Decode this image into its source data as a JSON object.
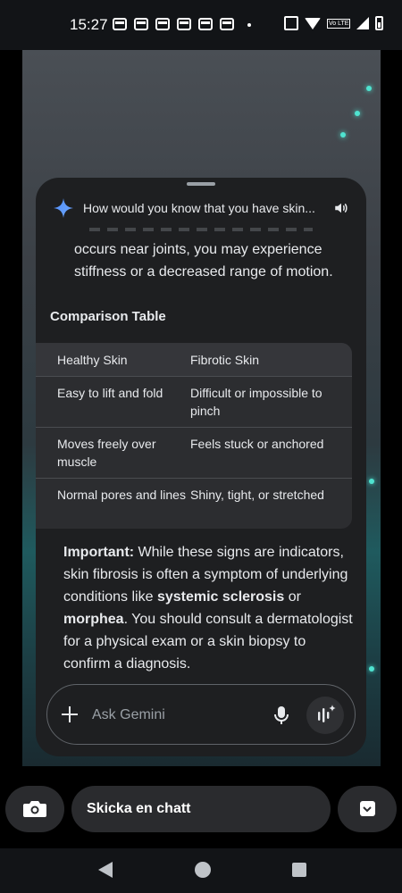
{
  "status_bar": {
    "time": "15:27",
    "notification_icons": [
      "notification-icon",
      "notification-icon",
      "notification-icon",
      "notification-icon",
      "notification-icon",
      "notification-icon"
    ],
    "volte_label": "Vo LTE"
  },
  "gemini": {
    "prompt_title": "How would you know that you have skin...",
    "body_text": "occurs near joints, you may experience stiffness or a decreased range of motion.",
    "table_heading": "Comparison Table",
    "table": {
      "headers": [
        "Healthy Skin",
        "Fibrotic Skin"
      ],
      "rows": [
        [
          "Easy to lift and fold",
          "Difficult or impossible to pinch"
        ],
        [
          "Moves freely over muscle",
          "Feels stuck or anchored"
        ],
        [
          "Normal pores and lines",
          "Shiny, tight, or stretched"
        ]
      ]
    },
    "important": {
      "label": "Important:",
      "text_1": " While these signs are indicators, skin fibrosis is often a symptom of underlying conditions like ",
      "term_1": "systemic sclerosis",
      "text_2": " or ",
      "term_2": "morphea",
      "text_3": ". You should consult a dermatologist for a physical exam or a skin biopsy to confirm a diagnosis."
    },
    "input": {
      "placeholder": "Ask Gemini"
    }
  },
  "chat_bar": {
    "chat_placeholder": "Skicka en chatt"
  },
  "colors": {
    "panel_bg": "#1e1f21",
    "accent_blue": "#4f8cf7",
    "wallpaper_light": "#4fe3d0"
  }
}
